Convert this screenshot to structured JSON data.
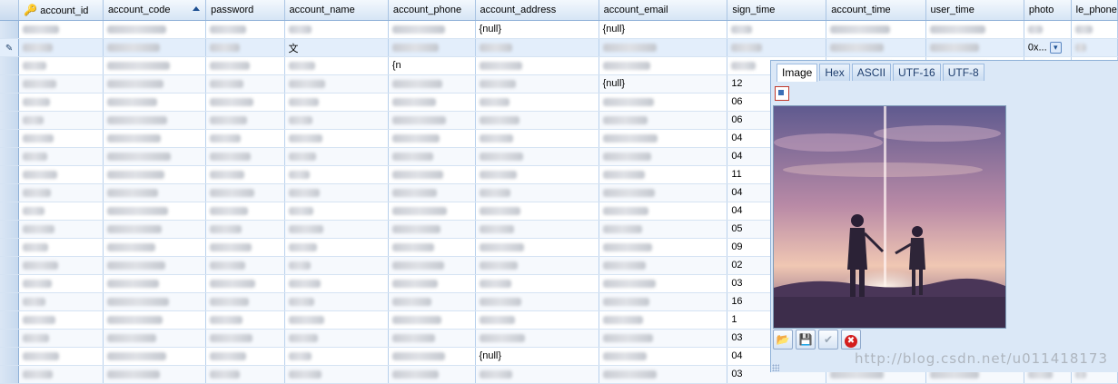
{
  "columns": [
    "account_id",
    "account_code",
    "password",
    "account_name",
    "account_phone",
    "account_address",
    "account_email",
    "sign_time",
    "account_time",
    "user_time",
    "photo",
    "le_phone"
  ],
  "rows": [
    {
      "marker": "",
      "cells": {
        "account_address": "{null}",
        "account_email": "{null}"
      }
    },
    {
      "marker": "edit",
      "cells": {
        "account_name": "文",
        "photo": "0x..."
      }
    },
    {
      "marker": "",
      "cells": {
        "account_phone": "{n"
      }
    },
    {
      "marker": "",
      "cells": {
        "account_email": "{null}",
        "sign_time": "12"
      }
    },
    {
      "marker": "",
      "cells": {
        "sign_time": "06"
      }
    },
    {
      "marker": "",
      "cells": {
        "sign_time": "06"
      }
    },
    {
      "marker": "",
      "cells": {
        "sign_time": "04"
      }
    },
    {
      "marker": "",
      "cells": {
        "sign_time": "04"
      }
    },
    {
      "marker": "",
      "cells": {
        "sign_time": "11"
      }
    },
    {
      "marker": "",
      "cells": {
        "sign_time": "04"
      }
    },
    {
      "marker": "",
      "cells": {
        "sign_time": "04"
      }
    },
    {
      "marker": "",
      "cells": {
        "sign_time": "05"
      }
    },
    {
      "marker": "",
      "cells": {
        "sign_time": "09"
      }
    },
    {
      "marker": "",
      "cells": {
        "sign_time": "02"
      }
    },
    {
      "marker": "",
      "cells": {
        "sign_time": "03"
      }
    },
    {
      "marker": "",
      "cells": {
        "sign_time": "16"
      }
    },
    {
      "marker": "",
      "cells": {
        "sign_time": "1"
      }
    },
    {
      "marker": "",
      "cells": {
        "sign_time": "03"
      }
    },
    {
      "marker": "",
      "cells": {
        "account_address": "{null}",
        "sign_time": "04"
      }
    },
    {
      "marker": "",
      "cells": {
        "sign_time": "03"
      }
    }
  ],
  "viewer": {
    "tabs": [
      "Image",
      "Hex",
      "ASCII",
      "UTF-16",
      "UTF-8"
    ],
    "active_tab": "Image",
    "watermark": "http://blog.csdn.net/u011418173"
  },
  "icons": {
    "key": "key-icon",
    "sort": "sort-ascending-icon",
    "edit_row": "pencil-icon",
    "fit": "fit-image-icon",
    "open": "open-folder-icon",
    "save": "save-icon",
    "ok": "check-icon",
    "cancel": "cancel-icon"
  },
  "colors": {
    "header_top": "#f3f8fd",
    "header_bottom": "#d6e5f5",
    "accent": "#1d4f91",
    "viewer_bg": "#dbe8f7"
  }
}
